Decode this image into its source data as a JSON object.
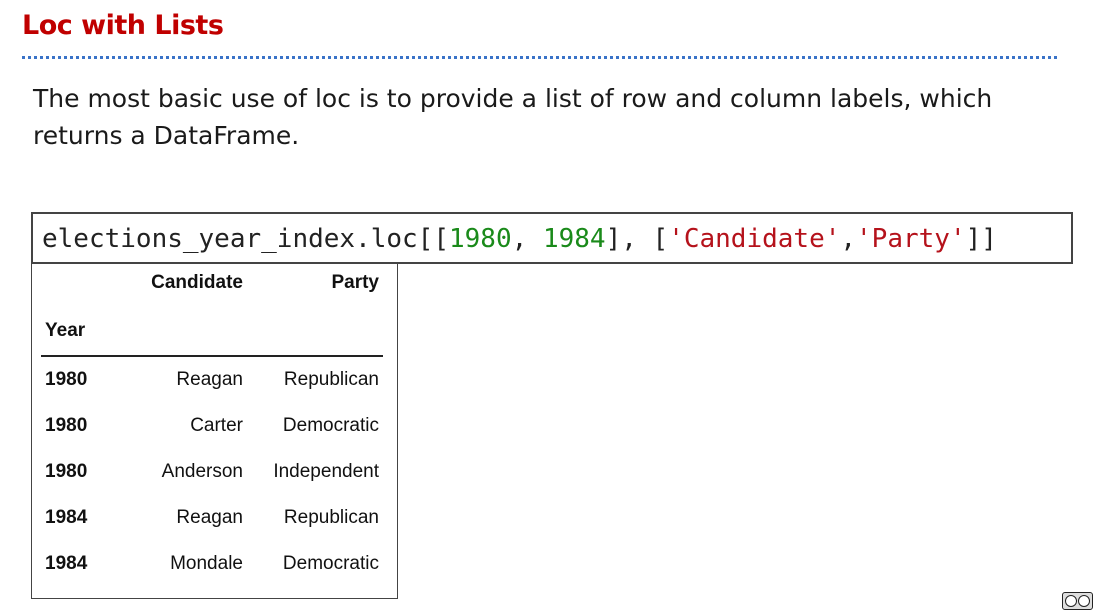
{
  "slide": {
    "title": "Loc with Lists",
    "body": "The most basic use of loc is to provide a list of row and column labels, which returns a DataFrame."
  },
  "code": {
    "object": "elections_year_index.loc[[",
    "num1": "1980",
    "sep1": ", ",
    "num2": "1984",
    "mid": "], [",
    "str1": "'Candidate'",
    "sep2": ",",
    "str2": "'Party'",
    "end": "]]"
  },
  "dataframe": {
    "columns": [
      "Candidate",
      "Party"
    ],
    "index_name": "Year",
    "rows": [
      {
        "index": "1980",
        "values": [
          "Reagan",
          "Republican"
        ]
      },
      {
        "index": "1980",
        "values": [
          "Carter",
          "Democratic"
        ]
      },
      {
        "index": "1980",
        "values": [
          "Anderson",
          "Independent"
        ]
      },
      {
        "index": "1984",
        "values": [
          "Reagan",
          "Republican"
        ]
      },
      {
        "index": "1984",
        "values": [
          "Mondale",
          "Democratic"
        ]
      }
    ]
  },
  "colors": {
    "title": "#c00000",
    "rule": "#3a73c8",
    "code_number": "#1a8a1a",
    "code_string": "#b5121b"
  },
  "icons": {
    "license": "cc-by-icon"
  }
}
